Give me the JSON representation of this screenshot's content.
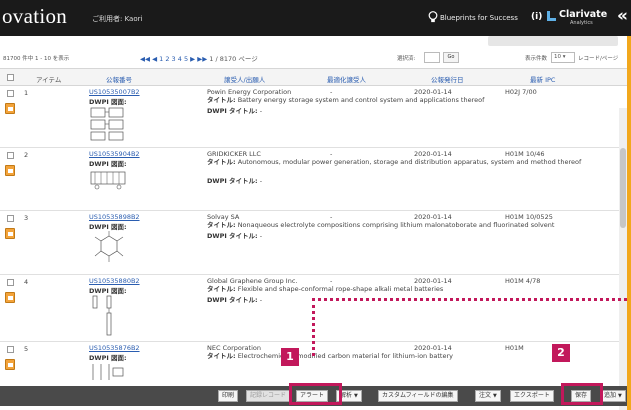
{
  "header": {
    "brand": "ovation",
    "user_label": "ご利用者: Kaori",
    "blueprints": "Blueprints for Success",
    "info": "(i)",
    "logo_name": "Clarivate",
    "logo_sub": "Analytics",
    "collapse": "«"
  },
  "pager": {
    "range": "81700 件中 1 - 10 を表示",
    "nav_prefix": "◀◀ ◀ ",
    "pages": "1 2 3 4 5",
    "nav_suffix": " ▶ ▶▶",
    "total": " 1 / 8170 ページ",
    "selected_label": "選択済:",
    "go": "Go",
    "perpage_label": "表示件数",
    "perpage_value": "10 ▾",
    "perpage_unit": "レコード/ページ"
  },
  "table": {
    "headers": {
      "item": "アイテム",
      "pubnum": "公報番号",
      "assignee": "譲受人/出願人",
      "opt_assignee": "最適化譲受人",
      "pubdate": "公報発行日",
      "ipc": "最新 IPC"
    },
    "dwpi_drawing_label": "DWPI 図面:",
    "title_label": "タイトル:",
    "dwpi_title_label": "DWPI タイトル:",
    "rows": [
      {
        "num": "1",
        "pub": "US10535007B2",
        "assignee": "Powin Energy Corporation",
        "opt": "-",
        "date": "2020-01-14",
        "ipc": "H02J 7/00",
        "title": "Battery energy storage system and control system and applications thereof",
        "dwpi_title": "-"
      },
      {
        "num": "2",
        "pub": "US10535904B2",
        "assignee": "GRIDKICKER LLC",
        "opt": "-",
        "date": "2020-01-14",
        "ipc": "H01M 10/46",
        "title": "Autonomous, modular power generation, storage and distribution apparatus, system and method thereof",
        "dwpi_title": "-"
      },
      {
        "num": "3",
        "pub": "US10535898B2",
        "assignee": "Solvay SA",
        "opt": "-",
        "date": "2020-01-14",
        "ipc": "H01M 10/0525",
        "title": "Nonaqueous electrolyte compositions comprising lithium malonatoborate and fluorinated solvent",
        "dwpi_title": "-"
      },
      {
        "num": "4",
        "pub": "US10535880B2",
        "assignee": "Global Graphene Group Inc.",
        "opt": "-",
        "date": "2020-01-14",
        "ipc": "H01M 4/78",
        "title": "Flexible and shape-conformal rope-shape alkali metal batteries",
        "dwpi_title": "-"
      },
      {
        "num": "5",
        "pub": "US10535876B2",
        "assignee": "NEC Corporation",
        "opt": "-",
        "date": "2020-01-14",
        "ipc": "H01M",
        "title": "Electrochemically modified carbon material for lithium-ion battery",
        "dwpi_title": ""
      }
    ]
  },
  "actions": {
    "print": "印刷",
    "tag_record": "記録レコード",
    "alert": "アラート",
    "analyze": "解析",
    "custom_field": "カスタムフィールドの編集",
    "order": "注文",
    "export": "エクスポート",
    "save": "保存",
    "add": "追加"
  },
  "callouts": {
    "one": "1",
    "two": "2"
  },
  "colors": {
    "header_bg": "#1a1a1a",
    "frame": "#f2a81d",
    "link": "#2a5db0",
    "callout": "#c2185b",
    "actionbar": "#4a4a4a"
  }
}
